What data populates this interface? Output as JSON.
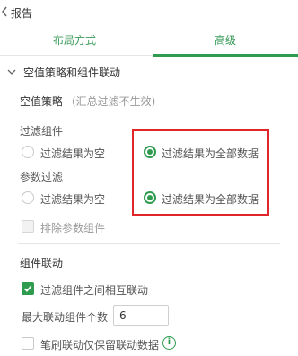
{
  "header": {
    "title": "报告"
  },
  "tabs": [
    {
      "label": "布局方式",
      "active": false
    },
    {
      "label": "高级",
      "active": true
    }
  ],
  "section": {
    "label": "空值策略和组件联动"
  },
  "null_strategy": {
    "title": "空值策略",
    "note": "(汇总过滤不生效)",
    "filter_component": {
      "label": "过滤组件",
      "options": [
        "过滤结果为空",
        "过滤结果为全部数据"
      ],
      "selected": "过滤结果为全部数据"
    },
    "param_filter": {
      "label": "参数过滤",
      "options": [
        "过滤结果为空",
        "过滤结果为全部数据"
      ],
      "selected": "过滤结果为全部数据"
    },
    "exclude_param": {
      "label": "排除参数组件",
      "checked": false,
      "disabled": true
    }
  },
  "linkage": {
    "title": "组件联动",
    "mutual": {
      "label": "过滤组件之间相互联动",
      "checked": true
    },
    "max_count": {
      "label": "最大联动组件个数",
      "value": "6"
    },
    "brush_keep": {
      "label": "笔刷联动仅保留联动数据",
      "checked": false
    }
  },
  "colors": {
    "accent": "#2e9b4f",
    "highlight": "#e0262b"
  },
  "icons": {
    "info": "i"
  }
}
